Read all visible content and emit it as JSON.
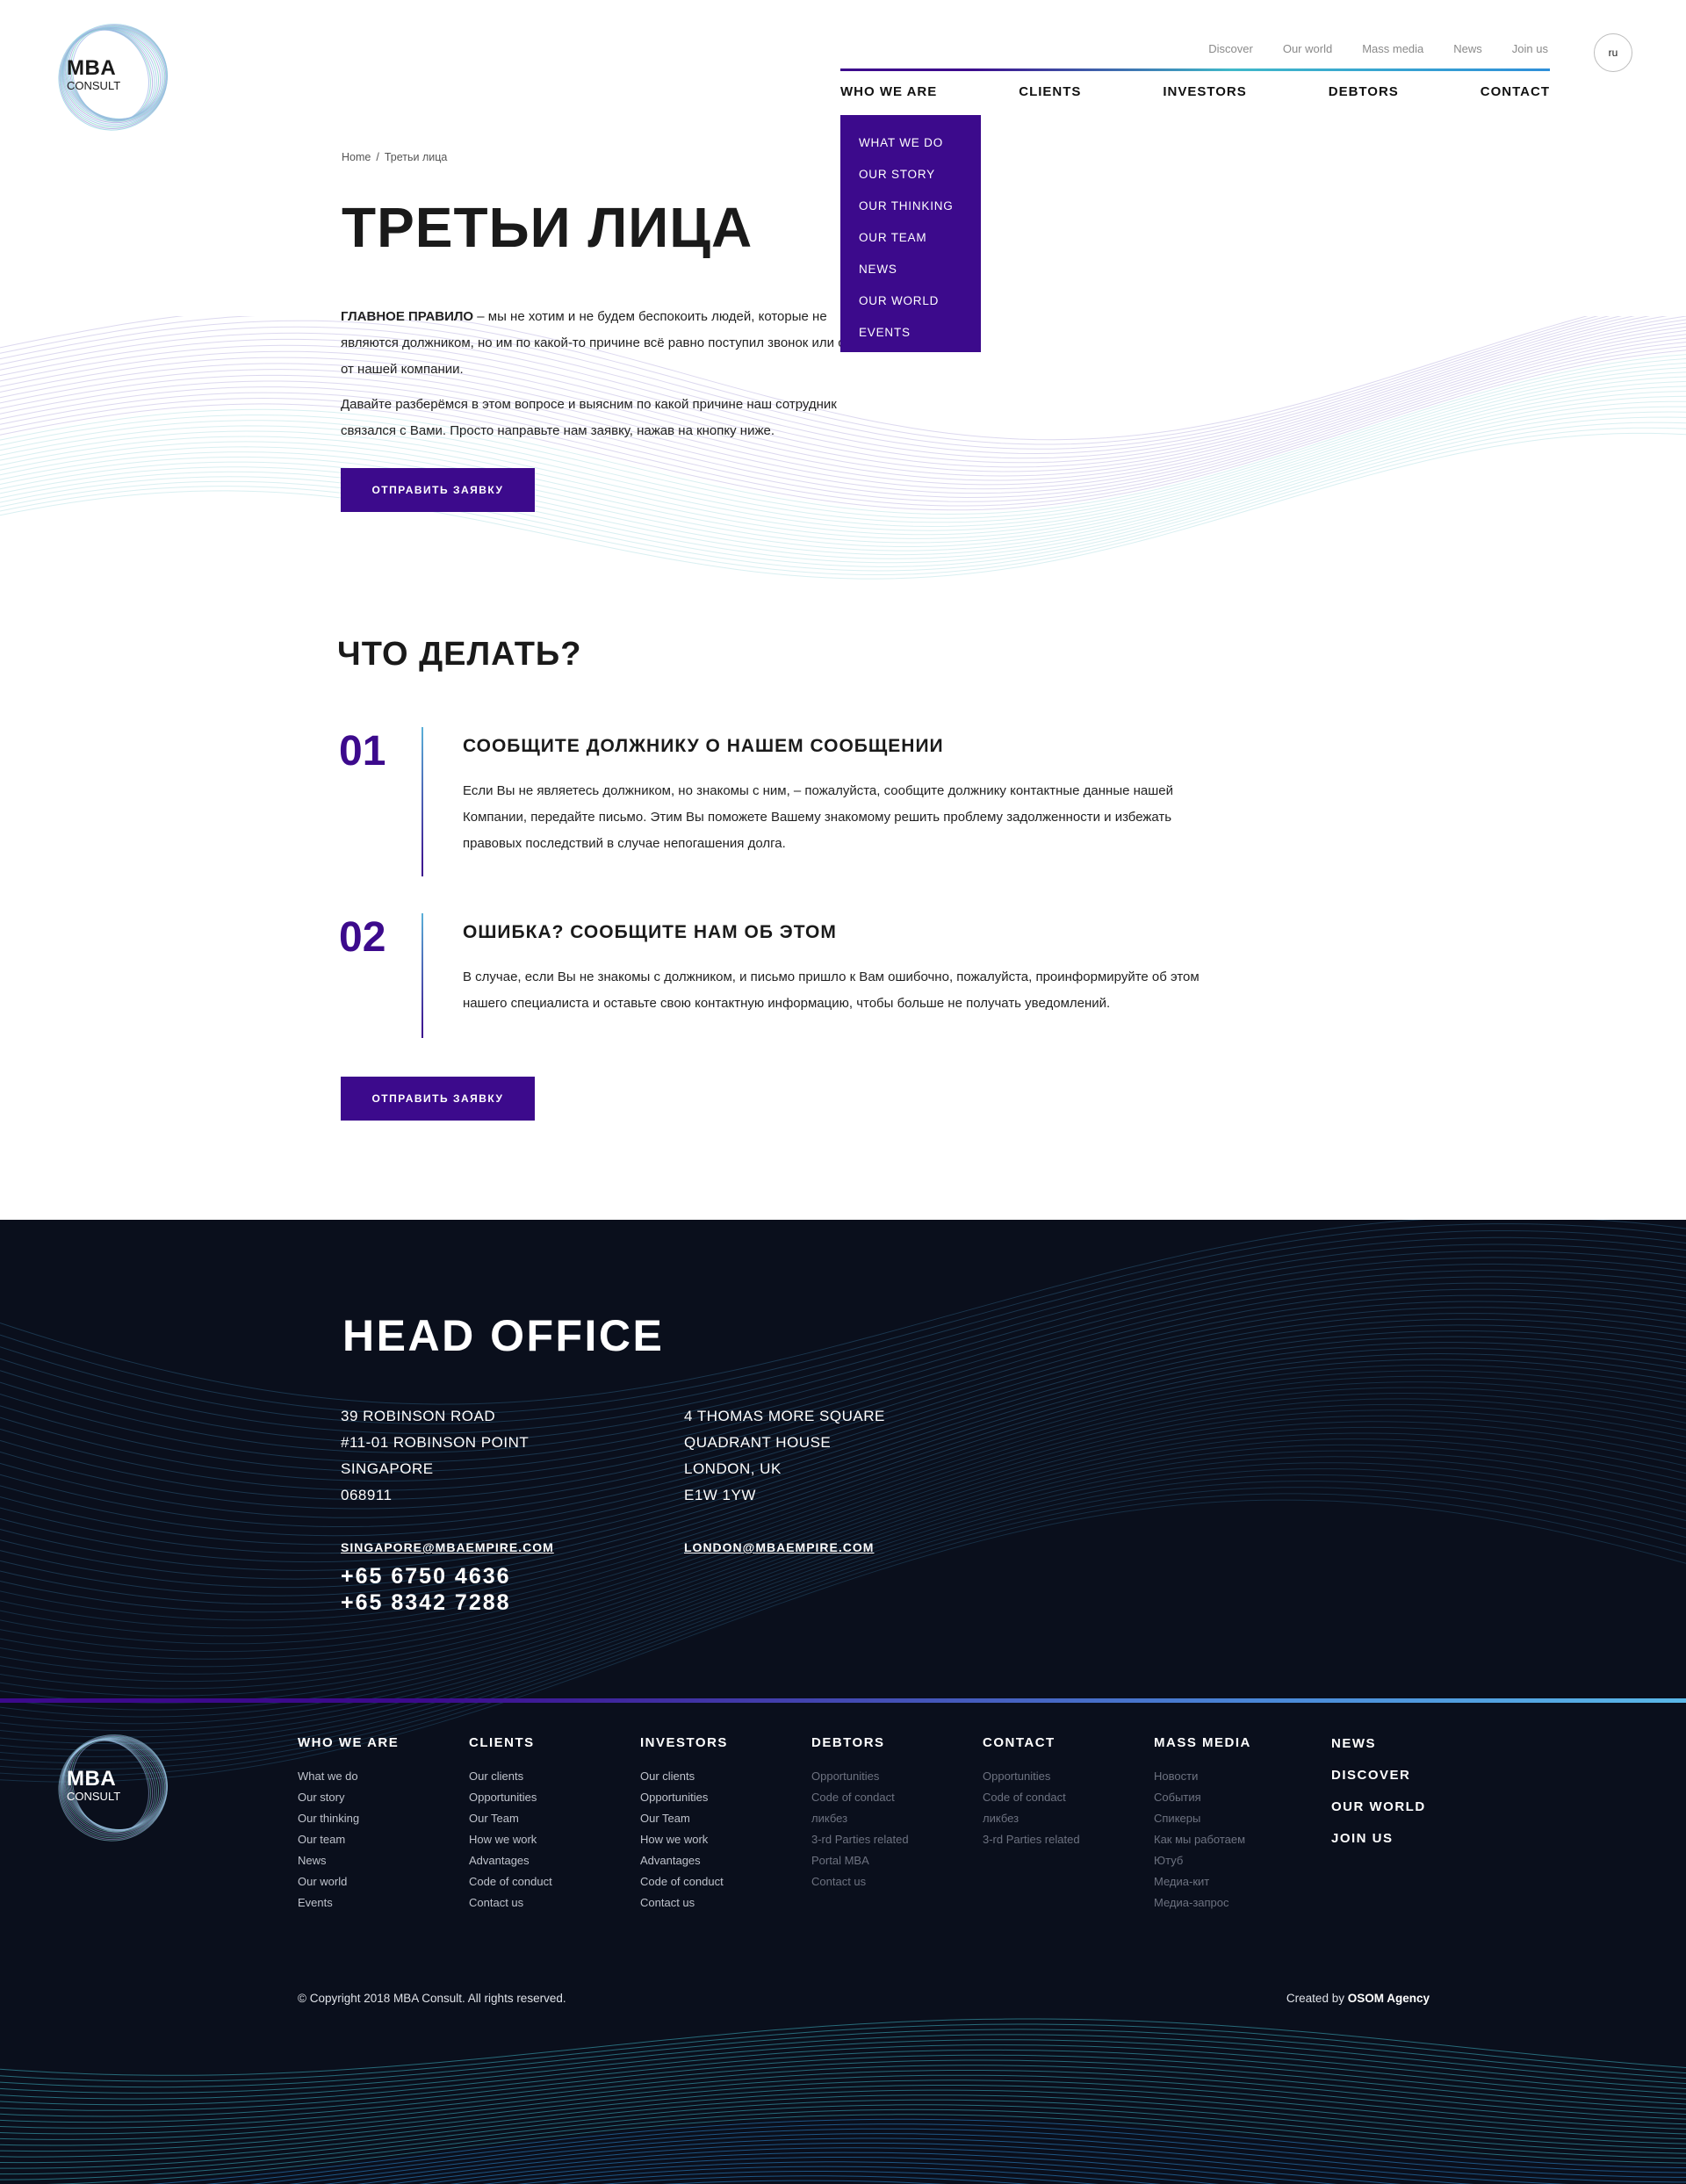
{
  "brand": {
    "name_main": "MBA",
    "name_sub": "CONSULT"
  },
  "header": {
    "top_links": [
      "Discover",
      "Our world",
      "Mass media",
      "News",
      "Join us"
    ],
    "lang": "ru",
    "main_nav": [
      "WHO WE ARE",
      "CLIENTS",
      "INVESTORS",
      "DEBTORS",
      "CONTACT"
    ],
    "dropdown": [
      "WHAT WE DO",
      "OUR STORY",
      "OUR THINKING",
      "OUR TEAM",
      "NEWS",
      "OUR WORLD",
      "EVENTS"
    ]
  },
  "breadcrumb": {
    "home": "Home",
    "sep": "/",
    "current": "Третьи лица"
  },
  "page": {
    "title": "ТРЕТЬИ ЛИЦА",
    "rule_label": "ГЛАВНОЕ ПРАВИЛО",
    "rule_text": " – мы не хотим и не будем беспокоить людей, которые не являются должником, но им по какой-то причине всё равно поступил звонок или смс от нашей компании.",
    "intro2": "Давайте разберёмся в этом вопросе и выясним по какой причине наш сотрудник связался с Вами. Просто направьте нам заявку, нажав на кнопку ниже.",
    "button": "ОТПРАВИТЬ ЗАЯВКУ",
    "what_title": "ЧТО ДЕЛАТЬ?",
    "steps": [
      {
        "num": "01",
        "title": "СООБЩИТЕ ДОЛЖНИКУ О НАШЕМ СООБЩЕНИИ",
        "text": "Если Вы не являетесь должником, но знакомы с ним, – пожалуйста, сообщите должнику контактные данные нашей Компании, передайте письмо. Этим Вы поможете Вашему знакомому решить проблему задолженности и избежать правовых последствий в случае непогашения долга."
      },
      {
        "num": "02",
        "title": "ОШИБКА? СООБЩИТЕ НАМ ОБ ЭТОМ",
        "text": "В случае, если Вы не знакомы с должником, и письмо пришло к Вам ошибочно, пожалуйста, проинформируйте об этом нашего специалиста и оставьте свою контактную информацию, чтобы больше не получать уведомлений."
      }
    ]
  },
  "office": {
    "title": "HEAD OFFICE",
    "singapore": [
      "39 ROBINSON ROAD",
      "#11-01 ROBINSON POINT",
      "SINGAPORE",
      "068911"
    ],
    "london": [
      "4 THOMAS MORE SQUARE",
      "QUADRANT HOUSE",
      "LONDON, UK",
      "E1W 1YW"
    ],
    "singapore_email": "SINGAPORE@MBAEMPIRE.COM",
    "london_email": "LONDON@MBAEMPIRE.COM",
    "phones": [
      "+65 6750 4636",
      "+65 8342 7288"
    ]
  },
  "footer": {
    "columns": [
      {
        "head": "WHO WE ARE",
        "links": [
          "What we do",
          "Our story",
          "Our thinking",
          "Our team",
          "News",
          "Our world",
          "Events"
        ],
        "dim": false
      },
      {
        "head": "CLIENTS",
        "links": [
          "Our clients",
          "Opportunities",
          "Our Team",
          "How we work",
          "Advantages",
          "Code of conduct",
          "Contact us"
        ],
        "dim": false
      },
      {
        "head": "INVESTORS",
        "links": [
          "Our clients",
          "Opportunities",
          "Our Team",
          "How we work",
          "Advantages",
          "Code of conduct",
          "Contact us"
        ],
        "dim": false
      },
      {
        "head": "DEBTORS",
        "links": [
          "Opportunities",
          "Code of condact",
          "ликбез",
          "3-rd Parties related",
          "Portal MBA",
          "Contact us"
        ],
        "dim": true
      },
      {
        "head": "CONTACT",
        "links": [
          "Opportunities",
          "Code of condact",
          "ликбез",
          "3-rd Parties related"
        ],
        "dim": true
      },
      {
        "head": "MASS MEDIA",
        "links": [
          "Новости",
          "События",
          "Спикеры",
          "Как мы работаем",
          "Ютуб",
          "Медиа-кит",
          "Медиа-запрос"
        ],
        "dim": true
      }
    ],
    "big_links": [
      "NEWS",
      "DISCOVER",
      "OUR WORLD",
      "JOIN US"
    ],
    "copyright": "© Copyright 2018 MBA Consult. All rights reserved.",
    "created_prefix": "Created by ",
    "created_by": "OSOM Agency"
  },
  "colors": {
    "accent": "#3c0a8c",
    "footer_bg": "#0a0f1c",
    "teal": "#3fb8c9"
  }
}
